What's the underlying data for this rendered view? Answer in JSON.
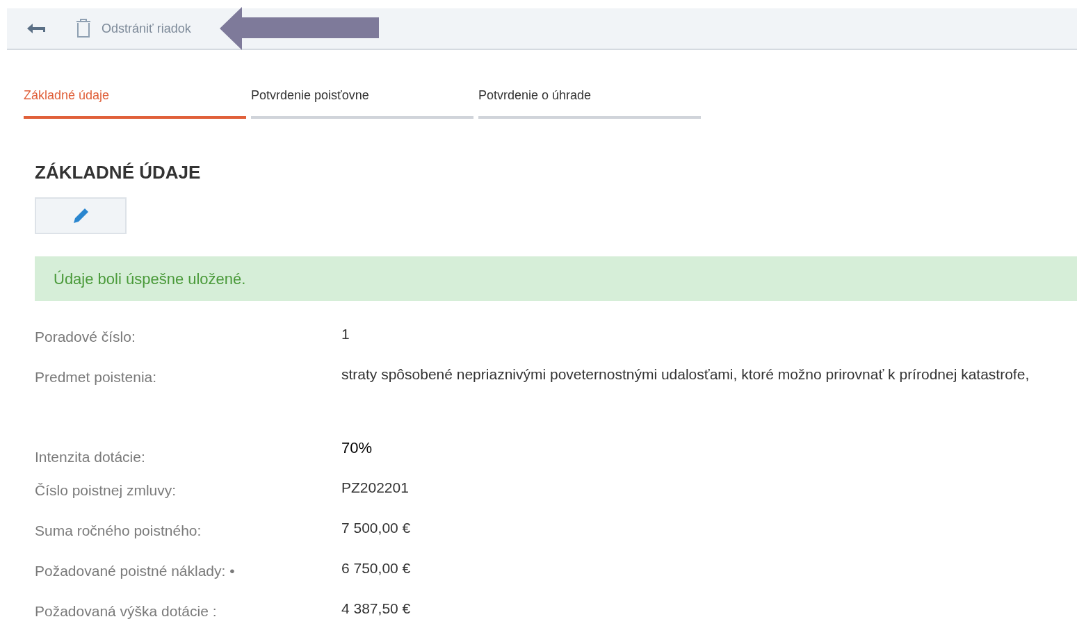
{
  "toolbar": {
    "delete_label": "Odstrániť riadok"
  },
  "tabs": [
    {
      "label": "Základné údaje",
      "selected": true
    },
    {
      "label": "Potvrdenie poisťovne",
      "selected": false
    },
    {
      "label": "Potvrdenie o úhrade",
      "selected": false
    }
  ],
  "section": {
    "title": "ZÁKLADNÉ ÚDAJE"
  },
  "alert": {
    "message": "Údaje boli úspešne uložené."
  },
  "fields": [
    {
      "label": "Poradové číslo:",
      "value": "1"
    },
    {
      "label": "Predmet poistenia:",
      "value": "straty spôsobené nepriaznivými poveternostnými udalosťami, ktoré možno prirovnať k prírodnej katastrofe,"
    },
    {
      "label": "Intenzita dotácie:",
      "value": "70%",
      "kind": "offset"
    },
    {
      "label": "Číslo poistnej zmluvy:",
      "value": "PZ202201"
    },
    {
      "label": "Suma ročného poistného:",
      "value": "7 500,00 €"
    },
    {
      "label": "Požadované poistné náklady: •",
      "value": "6 750,00 €"
    },
    {
      "label": "Požadovaná výška dotácie :",
      "value": "4 387,50 €"
    }
  ]
}
